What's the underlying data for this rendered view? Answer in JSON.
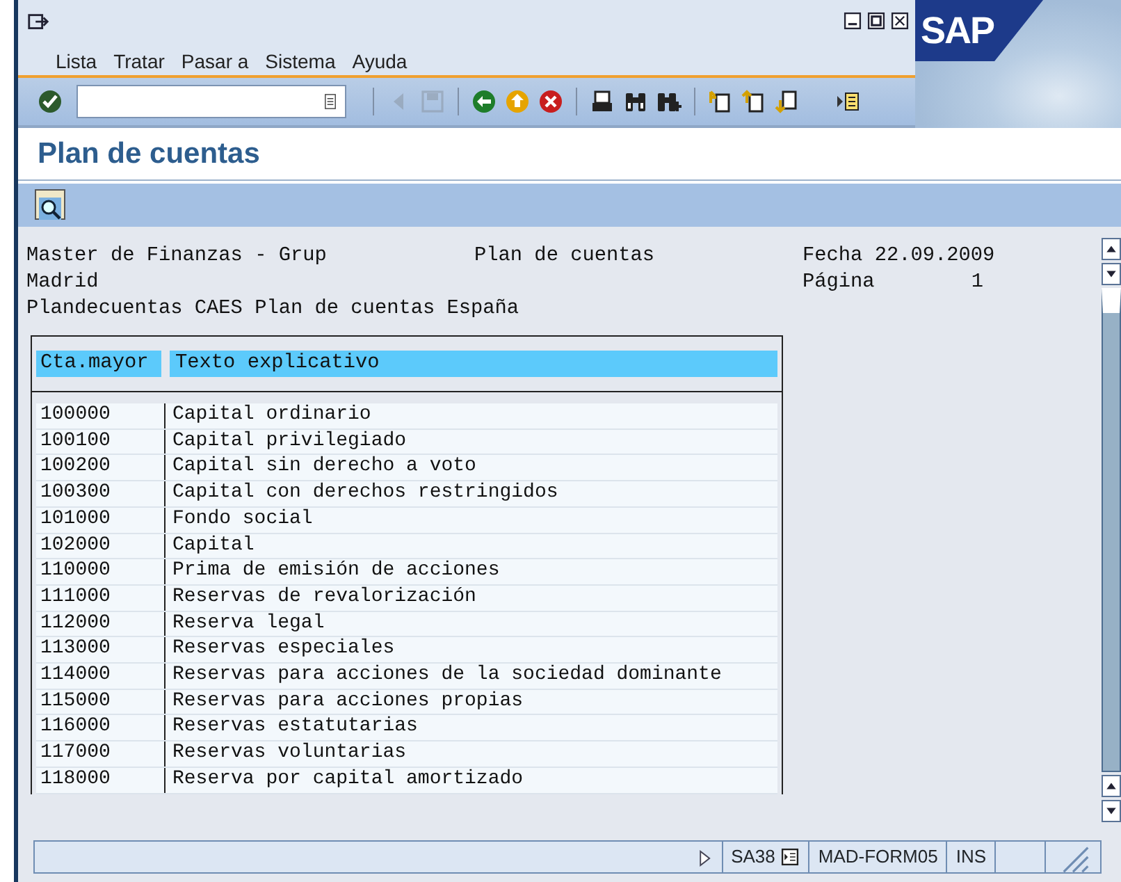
{
  "window": {
    "menu": [
      "Lista",
      "Tratar",
      "Pasar a",
      "Sistema",
      "Ayuda"
    ],
    "logo": "SAP"
  },
  "toolbar": [
    {
      "kind": "enter",
      "disabled": false
    },
    {
      "kind": "sep"
    },
    {
      "kind": "back_small",
      "disabled": true
    },
    {
      "kind": "save",
      "disabled": true
    },
    {
      "kind": "sep"
    },
    {
      "kind": "back",
      "disabled": false
    },
    {
      "kind": "exit",
      "disabled": false
    },
    {
      "kind": "cancel",
      "disabled": false
    },
    {
      "kind": "sep"
    },
    {
      "kind": "print",
      "disabled": false
    },
    {
      "kind": "find",
      "disabled": false
    },
    {
      "kind": "find_next",
      "disabled": false
    },
    {
      "kind": "sep"
    },
    {
      "kind": "first_page",
      "disabled": false
    },
    {
      "kind": "prev_page",
      "disabled": false
    },
    {
      "kind": "next_page",
      "disabled": false
    },
    {
      "kind": "gap"
    },
    {
      "kind": "layout",
      "disabled": false
    }
  ],
  "title": "Plan de cuentas",
  "report": {
    "header_lines": [
      {
        "left": "Master de Finanzas - Grup",
        "center": "Plan de cuentas",
        "right": "Fecha 22.09.2009"
      },
      {
        "left": "Madrid",
        "right": "Página",
        "number": "1"
      },
      {
        "left": "Plandecuentas CAES Plan de cuentas España"
      }
    ],
    "columns": [
      "Cta.mayor",
      "Texto explicativo"
    ],
    "rows": [
      [
        "100000",
        "Capital ordinario"
      ],
      [
        "100100",
        "Capital privilegiado"
      ],
      [
        "100200",
        "Capital sin derecho a voto"
      ],
      [
        "100300",
        "Capital con derechos restringidos"
      ],
      [
        "101000",
        "Fondo social"
      ],
      [
        "102000",
        "Capital"
      ],
      [
        "110000",
        "Prima de emisión de acciones"
      ],
      [
        "111000",
        "Reservas de revalorización"
      ],
      [
        "112000",
        "Reserva legal"
      ],
      [
        "113000",
        "Reservas especiales"
      ],
      [
        "114000",
        "Reservas para acciones de la sociedad dominante"
      ],
      [
        "115000",
        "Reservas para acciones propias"
      ],
      [
        "116000",
        "Reservas estatutarias"
      ],
      [
        "117000",
        "Reservas voluntarias"
      ],
      [
        "118000",
        "Reserva por capital amortizado"
      ]
    ]
  },
  "status_bar": {
    "transaction": "SA38",
    "server": "MAD-FORM05",
    "mode": "INS"
  }
}
